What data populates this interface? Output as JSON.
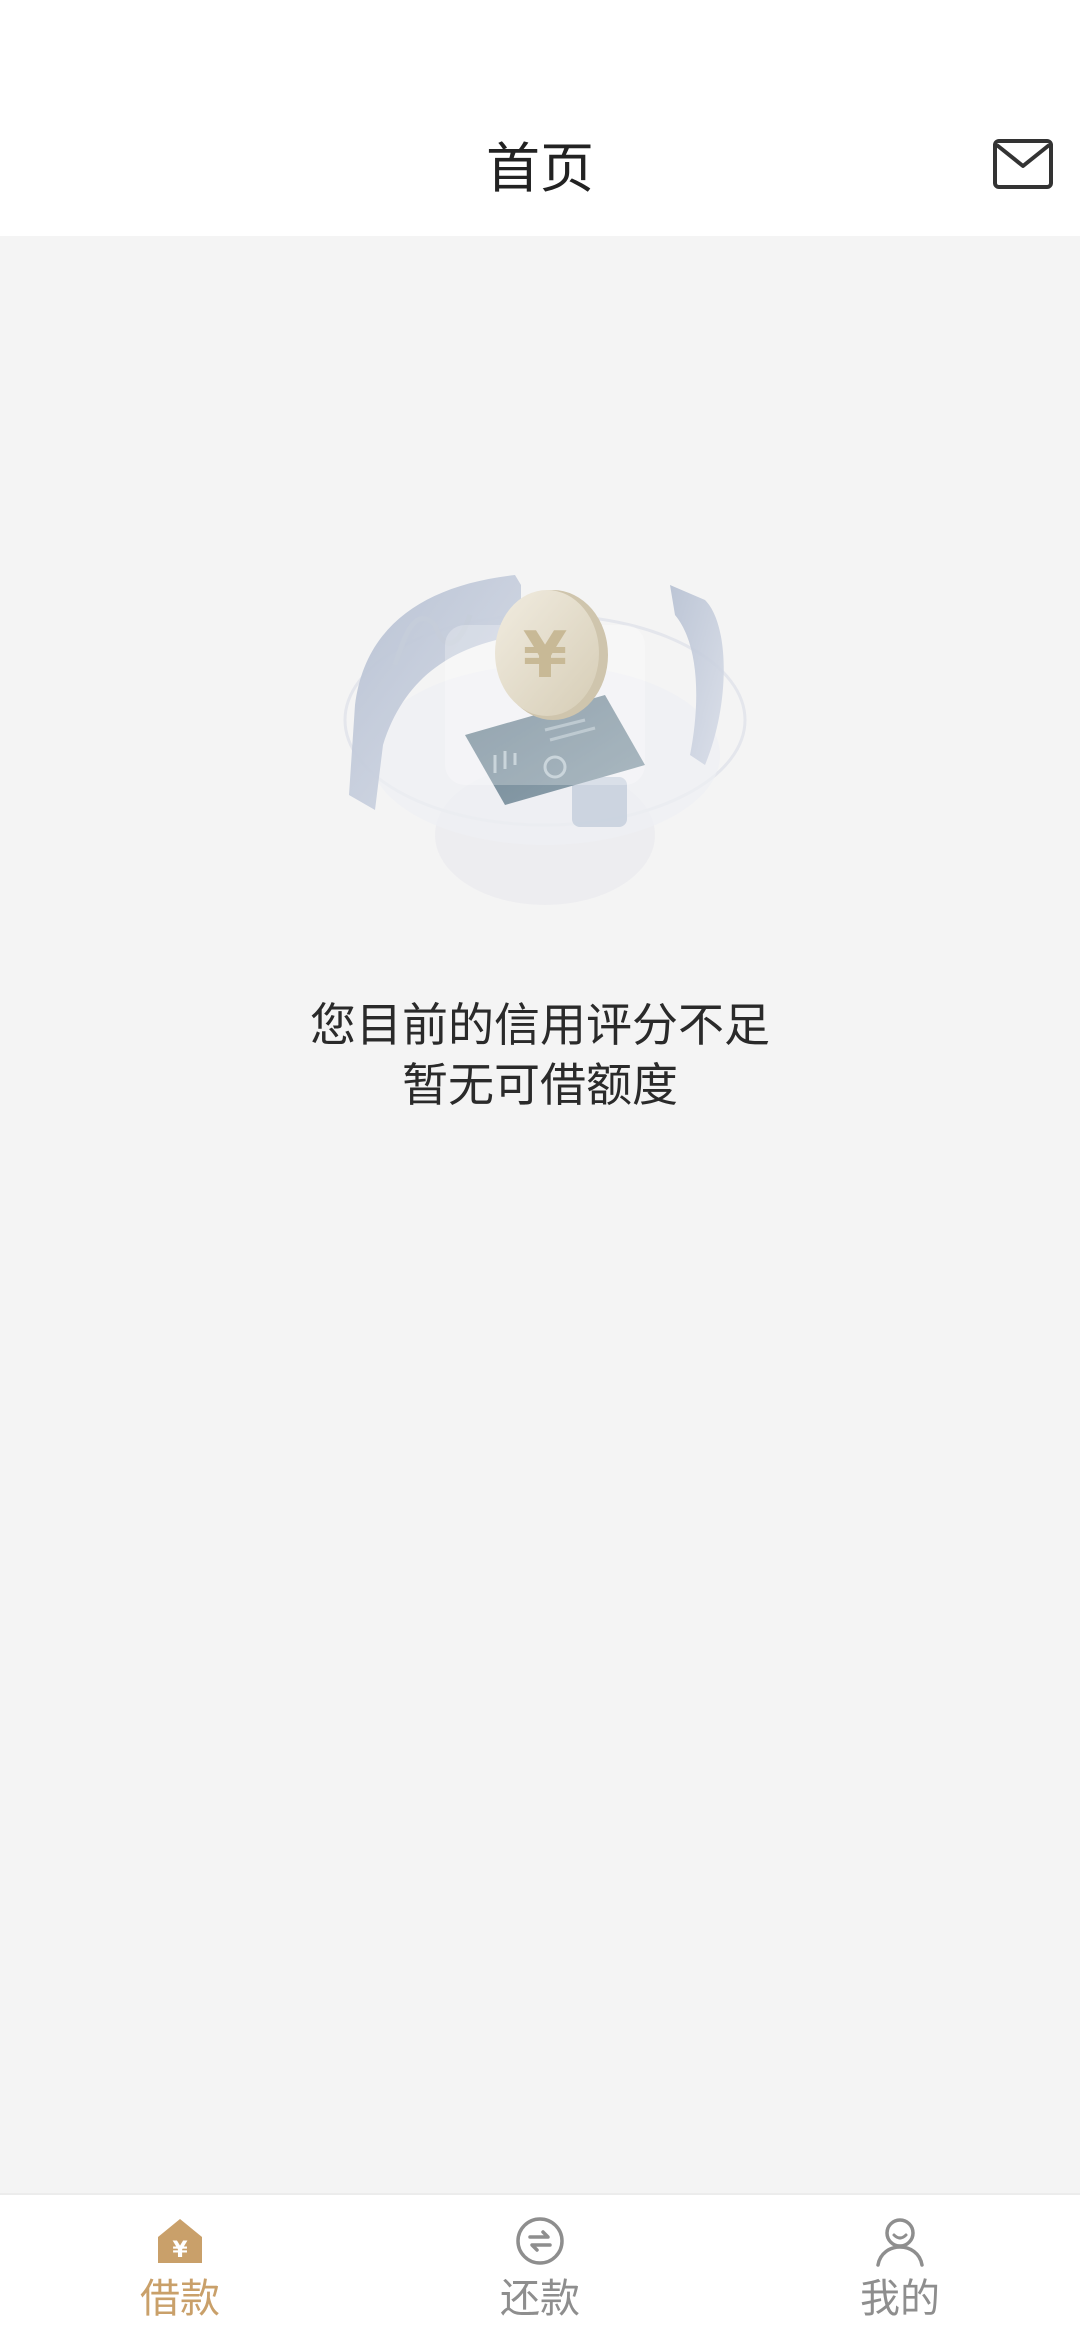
{
  "header": {
    "title": "首页",
    "mail_icon": "mail-icon"
  },
  "empty_state": {
    "illustration": "credit-coin-illustration",
    "message_line1": "您目前的信用评分不足",
    "message_line2": "暂无可借额度"
  },
  "tabbar": {
    "items": [
      {
        "label": "借款",
        "icon": "home-yuan-icon",
        "active": true
      },
      {
        "label": "还款",
        "icon": "repay-exchange-icon",
        "active": false
      },
      {
        "label": "我的",
        "icon": "user-profile-icon",
        "active": false
      }
    ]
  },
  "colors": {
    "accent": "#c9a06a",
    "inactive": "#8e8e8e",
    "background": "#f4f4f4",
    "text": "#222222"
  }
}
